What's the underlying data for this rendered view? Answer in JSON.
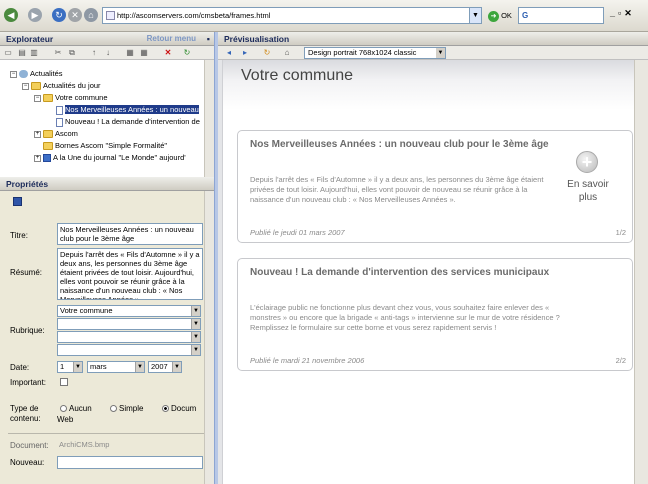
{
  "browser": {
    "url": "http://ascomservers.com/cmsbeta/frames.html",
    "go_label": "OK",
    "search_value": "G"
  },
  "explorer": {
    "title": "Explorateur",
    "back_link": "Retour menu",
    "tree": [
      {
        "label": "Actualités",
        "icon": "globe-icon"
      },
      {
        "label": "Actualités du jour",
        "icon": "folder-icon"
      },
      {
        "label": "Votre commune",
        "icon": "folder-icon"
      },
      {
        "label": "Nos Merveilleuses Années : un nouveau",
        "icon": "document-icon",
        "selected": true
      },
      {
        "label": "Nouveau ! La demande d'intervention de",
        "icon": "document-icon"
      },
      {
        "label": "Ascom",
        "icon": "folder-icon"
      },
      {
        "label": "Bornes Ascom \"Simple Formalité\"",
        "icon": "folder-icon"
      },
      {
        "label": "A la Une du journal \"Le Monde\" aujourd'",
        "icon": "feed-icon"
      }
    ]
  },
  "properties": {
    "title": "Propriétés",
    "titre_label": "Titre:",
    "titre_value": "Nos Merveilleuses Années : un nouveau club pour le 3ème âge",
    "resume_label": "Résumé:",
    "resume_value": "Depuis l'arrêt des « Fils d'Automne » il y a deux ans, les personnes du 3ème âge étaient privées de tout loisir. Aujourd'hui, elles vont pouvoir se réunir grâce à la naissance d'un nouveau club : « Nos Merveilleuses Années ».",
    "rubrique_label": "Rubrique:",
    "rubrique_values": [
      "Votre commune",
      "",
      "",
      ""
    ],
    "date_label": "Date:",
    "date_day": "1",
    "date_month": "mars",
    "date_year": "2007",
    "important_label": "Important:",
    "type_label_1": "Type de",
    "type_label_2": "contenu:",
    "type_options": [
      "Aucun",
      "Simple",
      "Docum"
    ],
    "type_selected": 2,
    "type_extra": "Web",
    "document_label": "Document:",
    "document_value": "ArchiCMS.bmp",
    "nouveau_label": "Nouveau:",
    "nouveau_value": ""
  },
  "preview": {
    "title": "Prévisualisation",
    "design": "Design portrait 768x1024 classic",
    "header_title": "Votre commune",
    "more_label": "En savoir plus",
    "cards": [
      {
        "title": "Nos Merveilleuses Années : un nouveau club pour le 3ème âge",
        "body": "Depuis l'arrêt des « Fils d'Automne » il y a deux ans, les personnes du 3ème âge étaient privées de tout loisir. Aujourd'hui, elles vont pouvoir de nouveau se réunir grâce à la naissance d'un nouveau club : « Nos Merveilleuses Années ».",
        "date": "Publié le jeudi 01 mars 2007",
        "page": "1/2"
      },
      {
        "title": "Nouveau ! La demande d'intervention des services municipaux",
        "body": "L'éclairage public ne fonctionne plus devant chez vous, vous souhaitez faire enlever des « monstres » ou encore que la brigade « anti-tags » intervienne sur le mur de votre résidence ? Remplissez le formulaire sur cette borne et vous serez rapidement servis !",
        "date": "Publié le mardi 21 novembre 2006",
        "page": "2/2"
      }
    ]
  }
}
